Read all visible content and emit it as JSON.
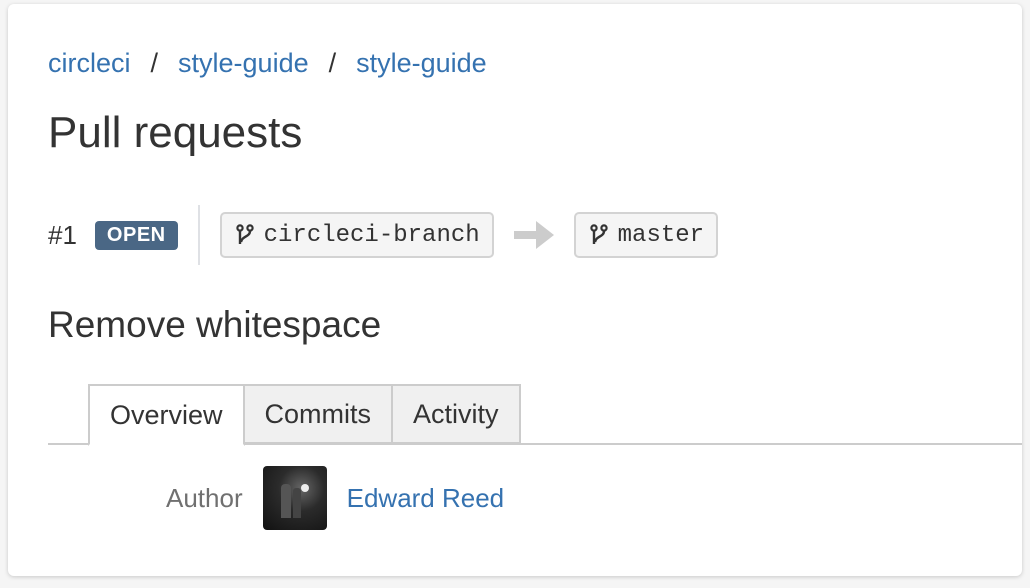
{
  "breadcrumb": {
    "items": [
      "circleci",
      "style-guide",
      "style-guide"
    ],
    "separator": "/"
  },
  "page": {
    "title": "Pull requests"
  },
  "pull_request": {
    "number": "#1",
    "status": "OPEN",
    "source_branch": "circleci-branch",
    "target_branch": "master",
    "title": "Remove whitespace"
  },
  "tabs": [
    {
      "label": "Overview",
      "active": true
    },
    {
      "label": "Commits",
      "active": false
    },
    {
      "label": "Activity",
      "active": false
    }
  ],
  "author": {
    "label": "Author",
    "name": "Edward Reed"
  },
  "colors": {
    "link": "#3572b0",
    "status_badge": "#4a6785",
    "text": "#333333"
  },
  "icons": {
    "branch": "branch-icon",
    "arrow": "arrow-right-icon"
  }
}
